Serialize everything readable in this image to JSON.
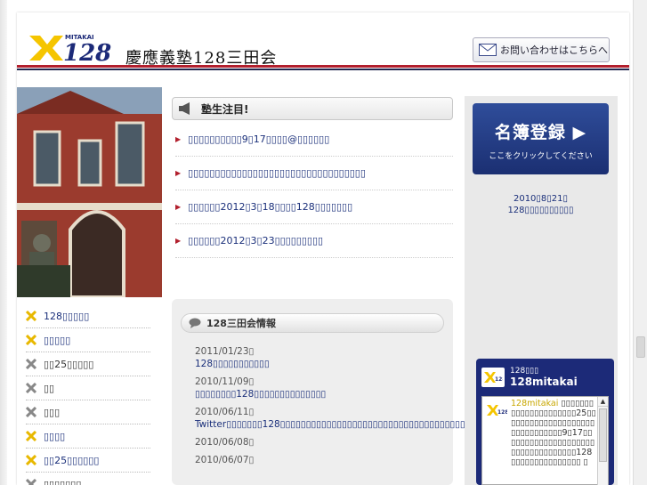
{
  "header": {
    "logo_text": "MITAKAI 128",
    "site_title": "慶應義塾128三田会",
    "contact_label": "お問い合わせはこちらへ"
  },
  "notice": {
    "heading": "塾生注目!",
    "items": [
      "▯▯▯▯▯▯▯▯▯▯9▯17▯▯▯▯@▯▯▯▯▯▯",
      "▯▯▯▯▯▯▯▯▯▯▯▯▯▯▯▯▯▯▯▯▯▯▯▯▯▯▯▯▯▯▯▯▯",
      "▯▯▯▯▯▯2012▯3▯18▯▯▯▯128▯▯▯▯▯▯▯",
      "▯▯▯▯▯▯2012▯3▯23▯▯▯▯▯▯▯▯▯"
    ]
  },
  "info": {
    "heading": "128三田会情報",
    "items": [
      {
        "date": "2011/01/23▯",
        "title": "128▯▯▯▯▯▯▯▯▯▯▯"
      },
      {
        "date": "2010/11/09▯",
        "title": "▯▯▯▯▯▯▯▯128▯▯▯▯▯▯▯▯▯▯▯▯▯▯"
      },
      {
        "date": "2010/06/11▯",
        "title": "Twitter▯▯▯▯▯▯▯128▯▯▯▯▯▯▯▯▯▯▯▯▯▯▯▯▯▯▯▯▯▯▯▯▯▯▯▯▯▯▯▯▯▯▯▯▯▯▯▯"
      },
      {
        "date": "2010/06/08▯",
        "title": ""
      },
      {
        "date": "2010/06/07▯",
        "title": ""
      }
    ]
  },
  "menu": {
    "items": [
      {
        "label": "128▯▯▯▯▯",
        "color": "#e8b800"
      },
      {
        "label": "▯▯▯▯▯",
        "color": "#e8b800"
      },
      {
        "label": "▯▯25▯▯▯▯▯",
        "color": "#888888"
      },
      {
        "label": "▯▯",
        "color": "#888888"
      },
      {
        "label": "▯▯▯",
        "color": "#888888"
      },
      {
        "label": "▯▯▯▯",
        "color": "#e8b800"
      },
      {
        "label": "▯▯25▯▯▯▯▯▯",
        "color": "#e8b800"
      },
      {
        "label": "▯▯▯▯▯▯▯",
        "color": "#888888"
      }
    ]
  },
  "register": {
    "big_label": "名簿登録 ▶",
    "small_label": "ここをクリックしてください",
    "note_line1": "2010▯8▯21▯",
    "note_line2": "128▯▯▯▯▯▯▯▯▯▯"
  },
  "twitter": {
    "small_name": "128▯▯▯",
    "name": "128mitakai",
    "handle": "128mitakai",
    "text": " ▯▯▯▯▯▯▯▯▯▯▯▯▯▯▯▯▯▯▯▯▯25▯▯▯▯▯▯▯▯▯▯▯▯▯▯▯▯▯▯▯▯▯▯▯▯▯▯▯▯▯▯▯9▯17▯▯▯▯▯▯▯▯▯▯▯▯▯▯▯▯▯▯▯▯▯▯▯▯▯▯▯▯▯▯▯▯▯▯128▯▯▯▯▯▯▯▯▯▯▯▯▯▯▯ ▯"
  },
  "colors": {
    "accent_red": "#b21f2d",
    "navy": "#23284f",
    "link_blue": "#1a2f7a",
    "logo_yellow": "#f5c500"
  }
}
